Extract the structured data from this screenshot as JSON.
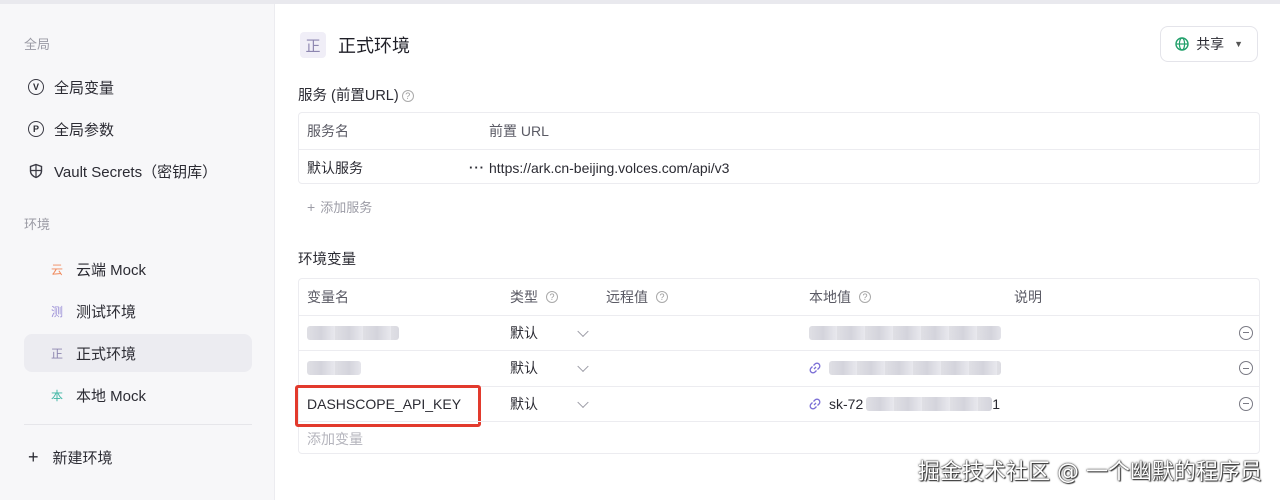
{
  "sidebar": {
    "global_section": "全局",
    "global_items": [
      {
        "icon": "variable-circle-icon",
        "glyph": "V",
        "label": "全局变量"
      },
      {
        "icon": "parameter-circle-icon",
        "glyph": "P",
        "label": "全局参数"
      },
      {
        "icon": "shield-icon",
        "glyph": "",
        "label": "Vault Secrets（密钥库）"
      }
    ],
    "env_section": "环境",
    "envs": [
      {
        "badge": "云",
        "badge_color": "#f08a5d",
        "label": "云端 Mock",
        "active": false
      },
      {
        "badge": "测",
        "badge_color": "#9b8fd6",
        "label": "测试环境",
        "active": false
      },
      {
        "badge": "正",
        "badge_color": "#8d86b0",
        "label": "正式环境",
        "active": true
      },
      {
        "badge": "本",
        "badge_color": "#3fb6a5",
        "label": "本地 Mock",
        "active": false
      }
    ],
    "new_env": "新建环境"
  },
  "header": {
    "badge": "正",
    "title": "正式环境",
    "share_label": "共享"
  },
  "services": {
    "label": "服务 (前置URL)",
    "columns": [
      "服务名",
      "前置 URL"
    ],
    "rows": [
      {
        "name": "默认服务",
        "url": "https://ark.cn-beijing.volces.com/api/v3"
      }
    ],
    "add_label": "添加服务"
  },
  "variables": {
    "label": "环境变量",
    "columns": {
      "name": "变量名",
      "type": "类型",
      "remote": "远程值",
      "local": "本地值",
      "desc": "说明"
    },
    "rows": [
      {
        "name": "",
        "type": "默认",
        "local": ""
      },
      {
        "name": "",
        "type": "默认",
        "local": ""
      },
      {
        "name": "DASHSCOPE_API_KEY",
        "type": "默认",
        "local": "sk-72",
        "local_tail": "1"
      }
    ],
    "add_label": "添加变量"
  },
  "watermark": "掘金技术社区 @ 一个幽默的程序员",
  "colors": {
    "highlight": "#e23a2d",
    "link_icon": "#7b6fd6",
    "share_globe": "#22a06b"
  }
}
